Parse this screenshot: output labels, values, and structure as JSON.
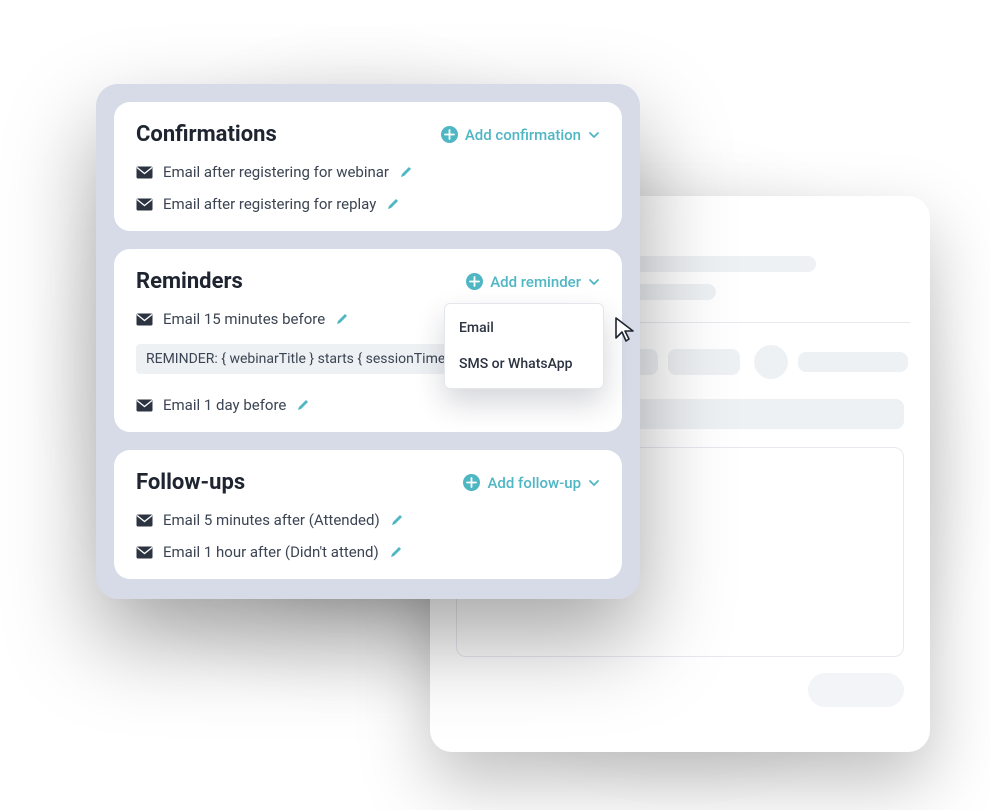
{
  "colors": {
    "accent": "#4fb6c4",
    "text": "#1e2430",
    "muted": "#3b4453"
  },
  "sections": {
    "confirmations": {
      "title": "Confirmations",
      "add_label": "Add confirmation",
      "items": [
        {
          "label": "Email after registering for webinar"
        },
        {
          "label": "Email after registering for replay"
        }
      ]
    },
    "reminders": {
      "title": "Reminders",
      "add_label": "Add reminder",
      "dropdown": {
        "option_email": "Email",
        "option_sms": "SMS or WhatsApp"
      },
      "items": [
        {
          "label": "Email 15 minutes before"
        },
        {
          "label": "Email 1 day before"
        }
      ],
      "template_chip": "REMINDER: { webinarTitle } starts { sessionTime left }"
    },
    "followups": {
      "title": "Follow-ups",
      "add_label": "Add follow-up",
      "items": [
        {
          "label": "Email 5 minutes after (Attended)"
        },
        {
          "label": "Email 1 hour after (Didn't attend)"
        }
      ]
    }
  }
}
